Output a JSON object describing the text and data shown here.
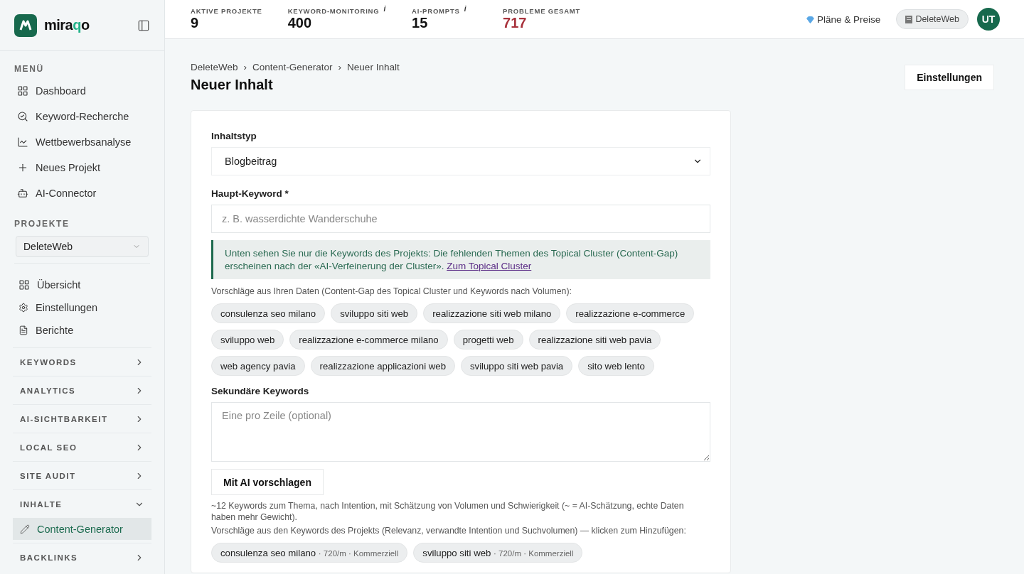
{
  "brand": {
    "name_start": "mira",
    "name_accent": "q",
    "name_end": "o"
  },
  "sidebar": {
    "menu_heading": "MENÜ",
    "menu_items": [
      {
        "label": "Dashboard"
      },
      {
        "label": "Keyword-Recherche"
      },
      {
        "label": "Wettbewerbsanalyse"
      },
      {
        "label": "Neues Projekt"
      },
      {
        "label": "AI-Connector"
      }
    ],
    "projects_heading": "PROJEKTE",
    "project_select": "DeleteWeb",
    "project_items": [
      {
        "label": "Übersicht"
      },
      {
        "label": "Einstellungen"
      },
      {
        "label": "Berichte"
      }
    ],
    "sections": [
      {
        "label": "KEYWORDS",
        "expanded": false
      },
      {
        "label": "ANALYTICS",
        "expanded": false
      },
      {
        "label": "AI-SICHTBARKEIT",
        "expanded": false
      },
      {
        "label": "LOCAL SEO",
        "expanded": false
      },
      {
        "label": "SITE AUDIT",
        "expanded": false
      },
      {
        "label": "INHALTE",
        "expanded": true,
        "children": [
          {
            "label": "Content-Generator",
            "selected": true
          }
        ]
      },
      {
        "label": "BACKLINKS",
        "expanded": false
      }
    ]
  },
  "stats": [
    {
      "label": "AKTIVE PROJEKTE",
      "value": "9",
      "alert": false
    },
    {
      "label": "KEYWORD-MONITORING",
      "value": "400",
      "info_mark": "i",
      "alert": false
    },
    {
      "label": "AI-PROMPTS",
      "value": "15",
      "info_mark": "i",
      "alert": false
    },
    {
      "label": "PROBLEME GESAMT",
      "value": "717",
      "alert": true
    }
  ],
  "top_right": {
    "plans": "Pläne & Preise",
    "workspace": "DeleteWeb",
    "avatar": "UT"
  },
  "breadcrumb": [
    "DeleteWeb",
    "Content-Generator",
    "Neuer Inhalt"
  ],
  "breadcrumb_separator": "›",
  "page_title": "Neuer Inhalt",
  "settings_button": "Einstellungen",
  "form": {
    "content_type_label": "Inhaltstyp",
    "content_type_value": "Blogbeitrag",
    "main_keyword_label": "Haupt-Keyword *",
    "main_keyword_placeholder": "z. B. wasserdichte Wanderschuhe",
    "notice_text": "Unten sehen Sie nur die Keywords des Projekts: Die fehlenden Themen des Topical Cluster (Content-Gap) erscheinen nach der «AI-Verfeinerung der Cluster».",
    "notice_link": "Zum Topical Cluster",
    "suggestions_label": "Vorschläge aus Ihren Daten (Content-Gap des Topical Cluster und Keywords nach Volumen):",
    "suggestions": [
      "consulenza seo milano",
      "sviluppo siti web",
      "realizzazione siti web milano",
      "realizzazione e-commerce",
      "sviluppo web",
      "realizzazione e-commerce milano",
      "progetti web",
      "realizzazione siti web pavia",
      "web agency pavia",
      "realizzazione applicazioni web",
      "sviluppo siti web pavia",
      "sito web lento"
    ],
    "secondary_label": "Sekundäre Keywords",
    "secondary_placeholder": "Eine pro Zeile (optional)",
    "ai_button": "Mit AI vorschlagen",
    "ai_hint": "~12 Keywords zum Thema, nach Intention, mit Schätzung von Volumen und Schwierigkeit (~ = AI-Schätzung, echte Daten haben mehr Gewicht).",
    "project_suggestions_label": "Vorschläge aus den Keywords des Projekts (Relevanz, verwandte Intention und Suchvolumen) — klicken zum Hinzufügen:",
    "project_suggestions": [
      {
        "keyword": "consulenza seo milano",
        "meta": "· 720/m · Kommerziell"
      },
      {
        "keyword": "sviluppo siti web",
        "meta": "· 720/m · Kommerziell"
      }
    ]
  }
}
